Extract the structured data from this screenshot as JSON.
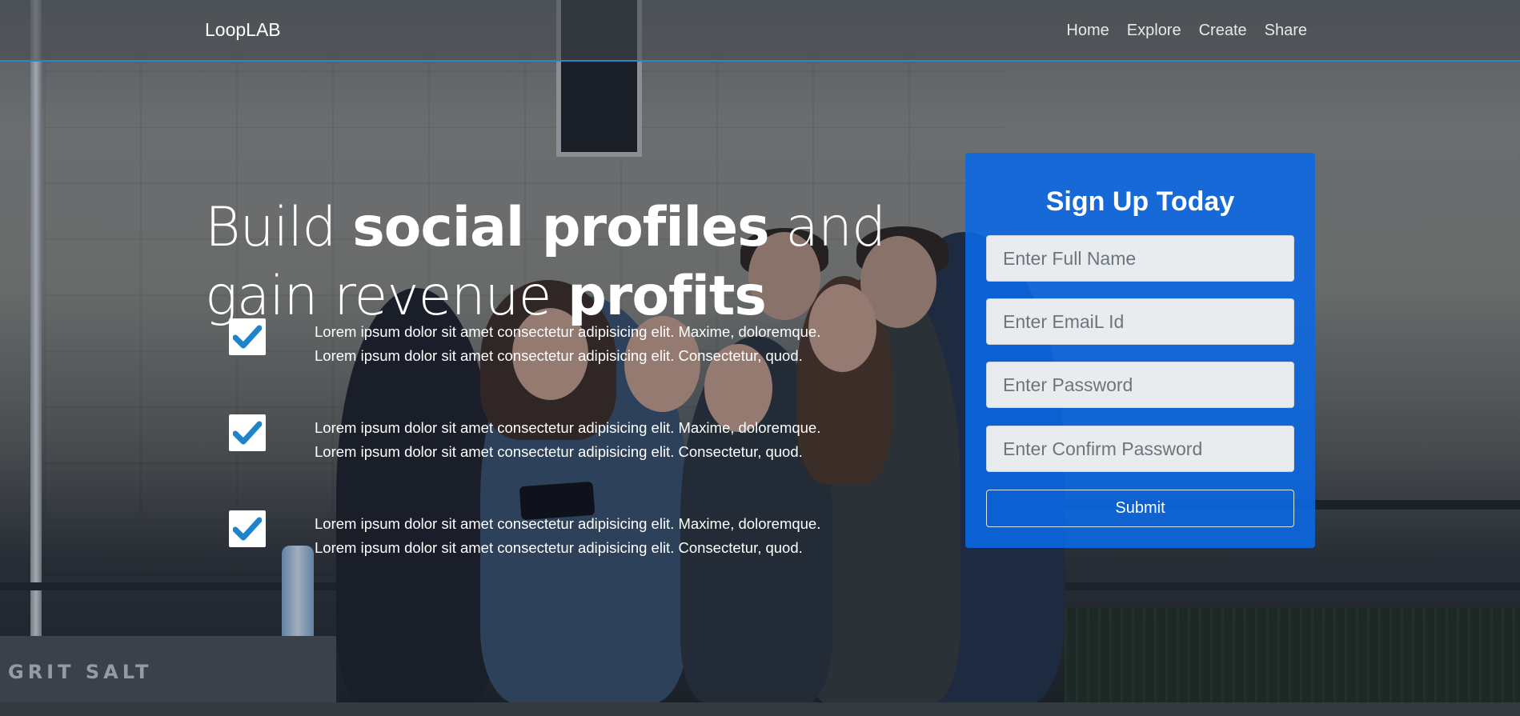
{
  "brand": "LoopLAB",
  "nav": {
    "items": [
      "Home",
      "Explore",
      "Create",
      "Share"
    ]
  },
  "hero": {
    "headline_part1": "Build ",
    "headline_bold1": "social profiles",
    "headline_part2": " and gain revenue ",
    "headline_bold2": "profits",
    "background_sign": "GRIT SALT",
    "features": [
      {
        "line1": "Lorem ipsum dolor sit amet consectetur adipisicing elit. Maxime, doloremque.",
        "line2": "Lorem ipsum dolor sit amet consectetur adipisicing elit. Consectetur, quod."
      },
      {
        "line1": "Lorem ipsum dolor sit amet consectetur adipisicing elit. Maxime, doloremque.",
        "line2": "Lorem ipsum dolor sit amet consectetur adipisicing elit. Consectetur, quod."
      },
      {
        "line1": "Lorem ipsum dolor sit amet consectetur adipisicing elit. Maxime, doloremque.",
        "line2": "Lorem ipsum dolor sit amet consectetur adipisicing elit. Consectetur, quod."
      }
    ],
    "check_icon": "check-icon"
  },
  "signup": {
    "title": "Sign Up Today",
    "fullname_placeholder": "Enter Full Name",
    "email_placeholder": "Enter EmaiL Id",
    "password_placeholder": "Enter Password",
    "confirm_placeholder": "Enter Confirm Password",
    "submit_label": "Submit"
  },
  "colors": {
    "accent_blue": "#0a69e6",
    "check_blue": "#1d84c9",
    "nav_border": "#2c86c4"
  }
}
